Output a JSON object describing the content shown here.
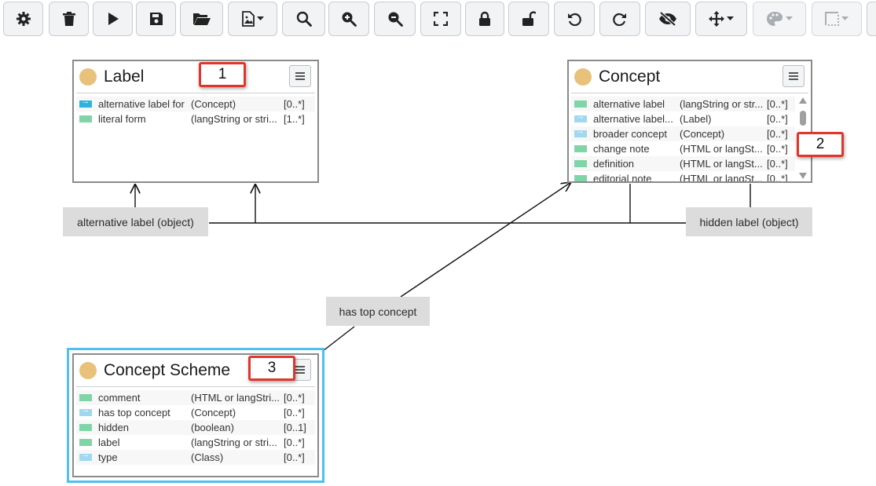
{
  "toolbar": {
    "buttons": [
      {
        "name": "settings-button",
        "icon": "gear-icon",
        "enabled": true
      },
      {
        "name": "delete-button",
        "icon": "trash-icon",
        "enabled": true
      },
      {
        "name": "play-button",
        "icon": "play-icon",
        "enabled": true
      },
      {
        "name": "save-button",
        "icon": "floppy-disk-icon",
        "enabled": true
      },
      {
        "name": "open-button",
        "icon": "folder-open-icon",
        "enabled": true
      },
      {
        "name": "export-image-button",
        "icon": "image-file-icon",
        "enabled": true,
        "dropdown": true
      },
      {
        "name": "search-button",
        "icon": "magnifier-icon",
        "enabled": true
      },
      {
        "name": "zoom-in-button",
        "icon": "zoom-in-icon",
        "enabled": true
      },
      {
        "name": "zoom-out-button",
        "icon": "zoom-out-icon",
        "enabled": true
      },
      {
        "name": "fit-to-screen-button",
        "icon": "fullscreen-icon",
        "enabled": true
      },
      {
        "name": "lock-button",
        "icon": "lock-icon",
        "enabled": true
      },
      {
        "name": "unlock-button",
        "icon": "unlock-icon",
        "enabled": true
      },
      {
        "name": "undo-button",
        "icon": "undo-icon",
        "enabled": true
      },
      {
        "name": "redo-button",
        "icon": "redo-icon",
        "enabled": true
      },
      {
        "name": "hide-button",
        "icon": "eye-slash-icon",
        "enabled": true
      },
      {
        "name": "move-button",
        "icon": "move-arrows-icon",
        "enabled": true,
        "dropdown": true
      },
      {
        "name": "color-button",
        "icon": "palette-icon",
        "enabled": false,
        "dropdown": true
      },
      {
        "name": "border-style-button",
        "icon": "border-style-icon",
        "enabled": false,
        "dropdown": true
      }
    ]
  },
  "classes": {
    "label": {
      "title": "Label",
      "menu_icon": "hamburger-menu-icon",
      "properties": [
        {
          "kind": "object-strong",
          "name": "alternative label for",
          "range": "(Concept)",
          "card": "[0..*]"
        },
        {
          "kind": "datatype",
          "name": "literal form",
          "range": "(langString or stri...",
          "card": "[1..*]"
        }
      ]
    },
    "concept": {
      "title": "Concept",
      "menu_icon": "hamburger-menu-icon",
      "properties": [
        {
          "kind": "datatype",
          "name": "alternative label",
          "range": "(langString or str...",
          "card": "[0..*]"
        },
        {
          "kind": "object",
          "name": "alternative label...",
          "range": "(Label)",
          "card": "[0..*]"
        },
        {
          "kind": "object",
          "name": "broader concept",
          "range": "(Concept)",
          "card": "[0..*]"
        },
        {
          "kind": "datatype",
          "name": "change note",
          "range": "(HTML or langSt...",
          "card": "[0..*]"
        },
        {
          "kind": "datatype",
          "name": "definition",
          "range": "(HTML or langSt...",
          "card": "[0..*]"
        },
        {
          "kind": "datatype",
          "name": "editorial note",
          "range": "(HTML or langSt...",
          "card": "[0..*]"
        }
      ]
    },
    "concept_scheme": {
      "title": "Concept Scheme",
      "menu_icon": "hamburger-menu-icon",
      "properties": [
        {
          "kind": "datatype",
          "name": "comment",
          "range": "(HTML or langStri...",
          "card": "[0..*]"
        },
        {
          "kind": "object",
          "name": "has top concept",
          "range": "(Concept)",
          "card": "[0..*]"
        },
        {
          "kind": "datatype",
          "name": "hidden",
          "range": "(boolean)",
          "card": "[0..1]"
        },
        {
          "kind": "datatype",
          "name": "label",
          "range": "(langString or stri...",
          "card": "[0..*]"
        },
        {
          "kind": "object",
          "name": "type",
          "range": "(Class)",
          "card": "[0..*]"
        }
      ]
    }
  },
  "edges": {
    "alternative_label": "alternative label (object)",
    "hidden_label": "hidden label (object)",
    "has_top_concept": "has top concept"
  },
  "callouts": {
    "c1": "1",
    "c2": "2",
    "c3": "3"
  },
  "colors": {
    "class_dot": "#e8c27a",
    "datatype_property": "#7fd4a8",
    "object_property": "#9fd8ef",
    "object_property_strong": "#29b5e0",
    "callout_border": "#e0352b",
    "selection": "#4fc0ef",
    "edge_label_bg": "#dcdcdc"
  }
}
